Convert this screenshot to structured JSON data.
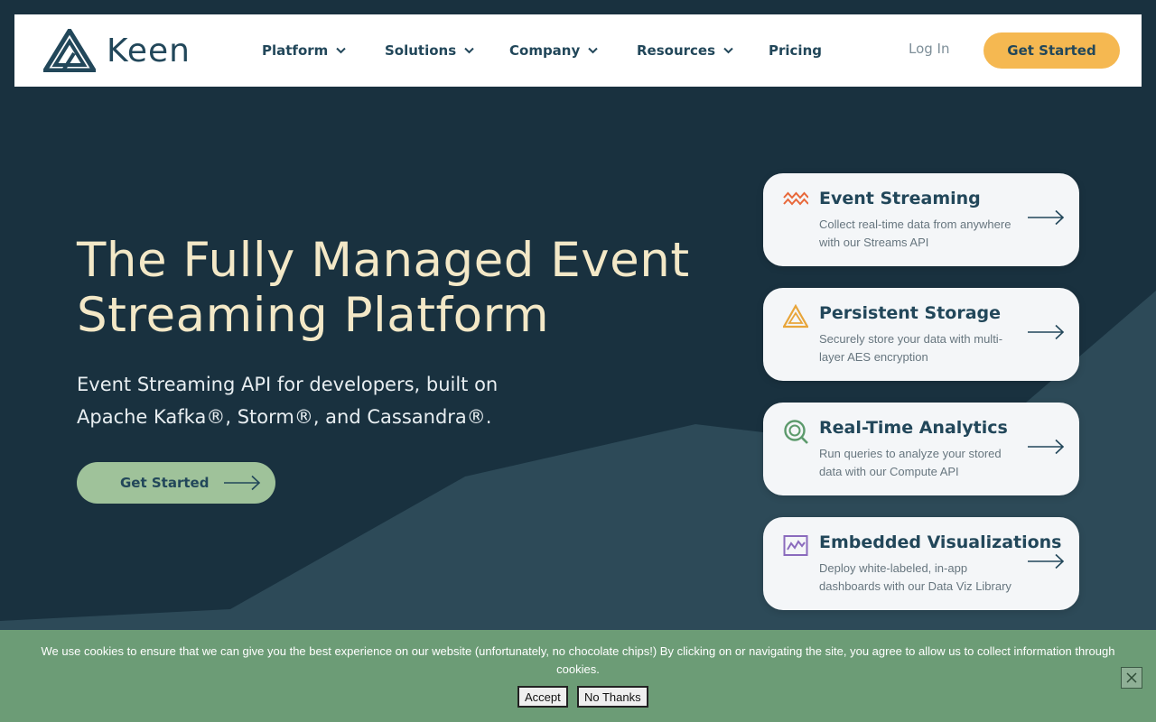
{
  "brand": {
    "name": "Keen"
  },
  "nav": {
    "items": [
      "Platform",
      "Solutions",
      "Company",
      "Resources",
      "Pricing"
    ],
    "login": "Log In",
    "cta": "Get Started"
  },
  "hero": {
    "title_line1": "The Fully Managed Event",
    "title_line2": "Streaming Platform",
    "subtitle_line1": "Event Streaming API for developers, built on",
    "subtitle_line2": "Apache Kafka®, Storm®, and Cassandra®.",
    "cta": "Get Started"
  },
  "cards": [
    {
      "title": "Event Streaming",
      "desc": "Collect real-time data from anywhere with our Streams API",
      "icon": "wave-icon",
      "color": "#e8683a"
    },
    {
      "title": "Persistent Storage",
      "desc": "Securely store your data with multi-layer AES encryption",
      "icon": "triangle-icon",
      "color": "#e8a53a"
    },
    {
      "title": "Real-Time Analytics",
      "desc": "Run queries to analyze your stored data with our Compute API",
      "icon": "magnifier-icon",
      "color": "#5c9a6c"
    },
    {
      "title": "Embedded Visualizations",
      "desc": "Deploy white-labeled, in-app dashboards with our Data Viz Library",
      "icon": "line-chart-icon",
      "color": "#8a6bbd"
    }
  ],
  "cookie": {
    "text": "We use cookies to ensure that we can give you the best experience on our website (unfortunately, no chocolate chips!) By clicking on or navigating the site, you agree to allow us to collect information through cookies.",
    "accept": "Accept",
    "decline": "No Thanks"
  },
  "colors": {
    "background": "#19313f",
    "accent_yellow": "#f5b851",
    "accent_green": "#9fc29a",
    "cookie_bg": "#6c9c76",
    "title_cream": "#f3e8c7"
  }
}
